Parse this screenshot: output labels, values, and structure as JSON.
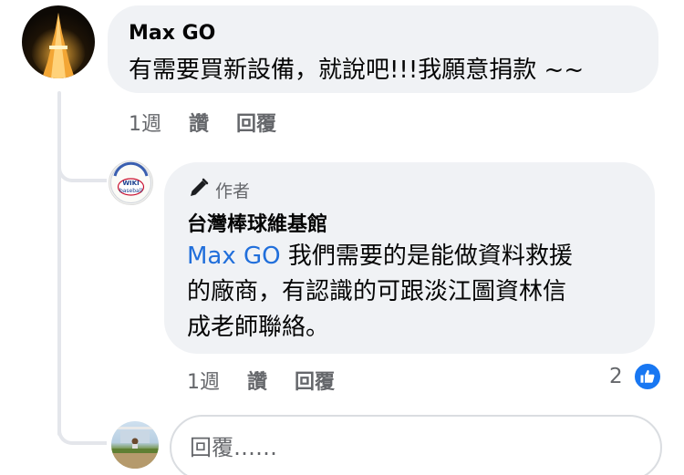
{
  "comment": {
    "author": "Max GO",
    "text": "有需要買新設備，就說吧!!!我願意捐款 ~~",
    "time": "1週",
    "like_label": "讚",
    "reply_label": "回覆"
  },
  "reply": {
    "author_badge": "作者",
    "author": "台灣棒球維基館",
    "mention": "Max GO",
    "text_line1": " 我們需要的是能做資料救援",
    "text_line2": "的廠商，有認識的可跟淡江圖資林信",
    "text_line3": "成老師聯絡。",
    "time": "1週",
    "like_label": "讚",
    "reply_label": "回覆",
    "reaction_count": "2",
    "avatar_text": "WIKI baseball"
  },
  "reply_input": {
    "placeholder": "回覆……"
  },
  "colors": {
    "bubble": "#f0f2f5",
    "link": "#216fdb",
    "like": "#1877f2",
    "muted": "#65676b"
  },
  "icons": {
    "author_badge": "pen-icon",
    "reaction": "thumbs-up-icon"
  }
}
